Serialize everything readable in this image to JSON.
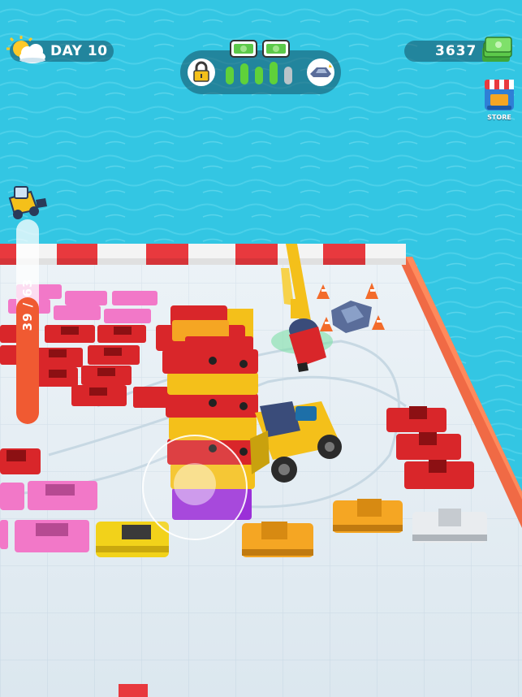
{
  "hud": {
    "day_label": "DAY 10",
    "cash_amount": "3637",
    "store_label": "STORE",
    "capacity_label": "39 / 63",
    "capacity_fraction": 0.62,
    "progress_bars_filled": 4,
    "progress_bars_total": 5,
    "weather_icon": "sun-cloud-icon",
    "lock_icon": "padlock-icon",
    "reward_icon": "cash-bundle-icon",
    "next_unlock_icon": "car-wreck-icon"
  },
  "colors": {
    "water": "#33c6e3",
    "floor": "#e6eef4",
    "barrier_red": "#e8393e",
    "barrier_white": "#f4f4f4",
    "bar_fill": "#f05a32",
    "progress_green": "#5fd13a",
    "cash_green": "#5cc94a"
  }
}
